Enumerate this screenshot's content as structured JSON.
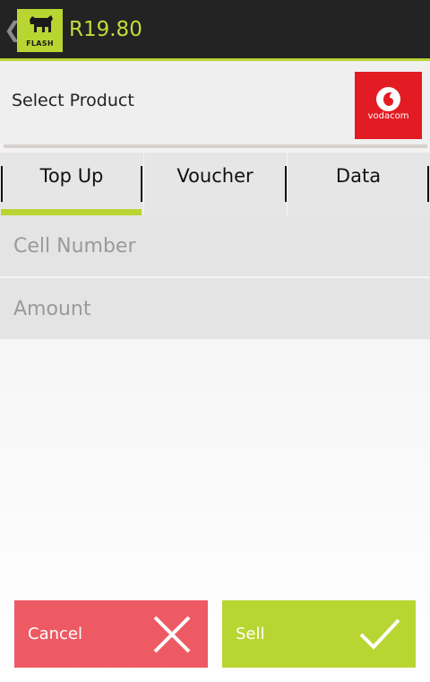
{
  "header": {
    "back_glyph": "❮",
    "logo_text": "FLASH",
    "balance": "R19.80"
  },
  "product": {
    "select_label": "Select Product",
    "brand_text": "vodacom"
  },
  "tabs": [
    {
      "label": "Top Up",
      "active": true
    },
    {
      "label": "Voucher",
      "active": false
    },
    {
      "label": "Data",
      "active": false
    }
  ],
  "form": {
    "cell_placeholder": "Cell Number",
    "amount_placeholder": "Amount"
  },
  "actions": {
    "cancel_label": "Cancel",
    "sell_label": "Sell"
  },
  "colors": {
    "accent": "#b9d532",
    "cancel": "#ee5a63",
    "vodacom_red": "#e31b23",
    "header_bg": "#232323"
  }
}
